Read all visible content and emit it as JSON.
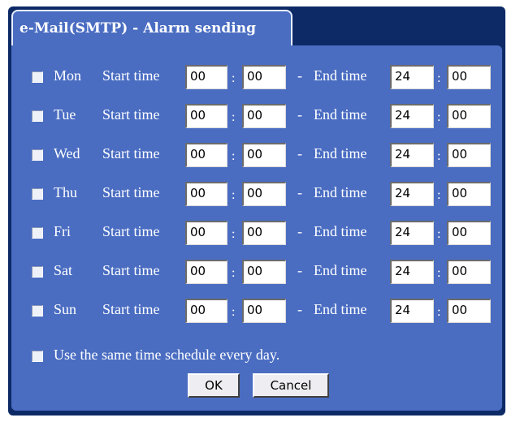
{
  "dialog": {
    "title": "e-Mail(SMTP) - Alarm sending"
  },
  "labels": {
    "start_time": "Start time",
    "end_time": "End time",
    "dash": "-",
    "colon": ":"
  },
  "days": [
    {
      "name": "Mon",
      "start_h": "00",
      "start_m": "00",
      "end_h": "24",
      "end_m": "00"
    },
    {
      "name": "Tue",
      "start_h": "00",
      "start_m": "00",
      "end_h": "24",
      "end_m": "00"
    },
    {
      "name": "Wed",
      "start_h": "00",
      "start_m": "00",
      "end_h": "24",
      "end_m": "00"
    },
    {
      "name": "Thu",
      "start_h": "00",
      "start_m": "00",
      "end_h": "24",
      "end_m": "00"
    },
    {
      "name": "Fri",
      "start_h": "00",
      "start_m": "00",
      "end_h": "24",
      "end_m": "00"
    },
    {
      "name": "Sat",
      "start_h": "00",
      "start_m": "00",
      "end_h": "24",
      "end_m": "00"
    },
    {
      "name": "Sun",
      "start_h": "00",
      "start_m": "00",
      "end_h": "24",
      "end_m": "00"
    }
  ],
  "same_schedule": {
    "label": "Use the same time schedule every day."
  },
  "buttons": {
    "ok": "OK",
    "cancel": "Cancel"
  }
}
